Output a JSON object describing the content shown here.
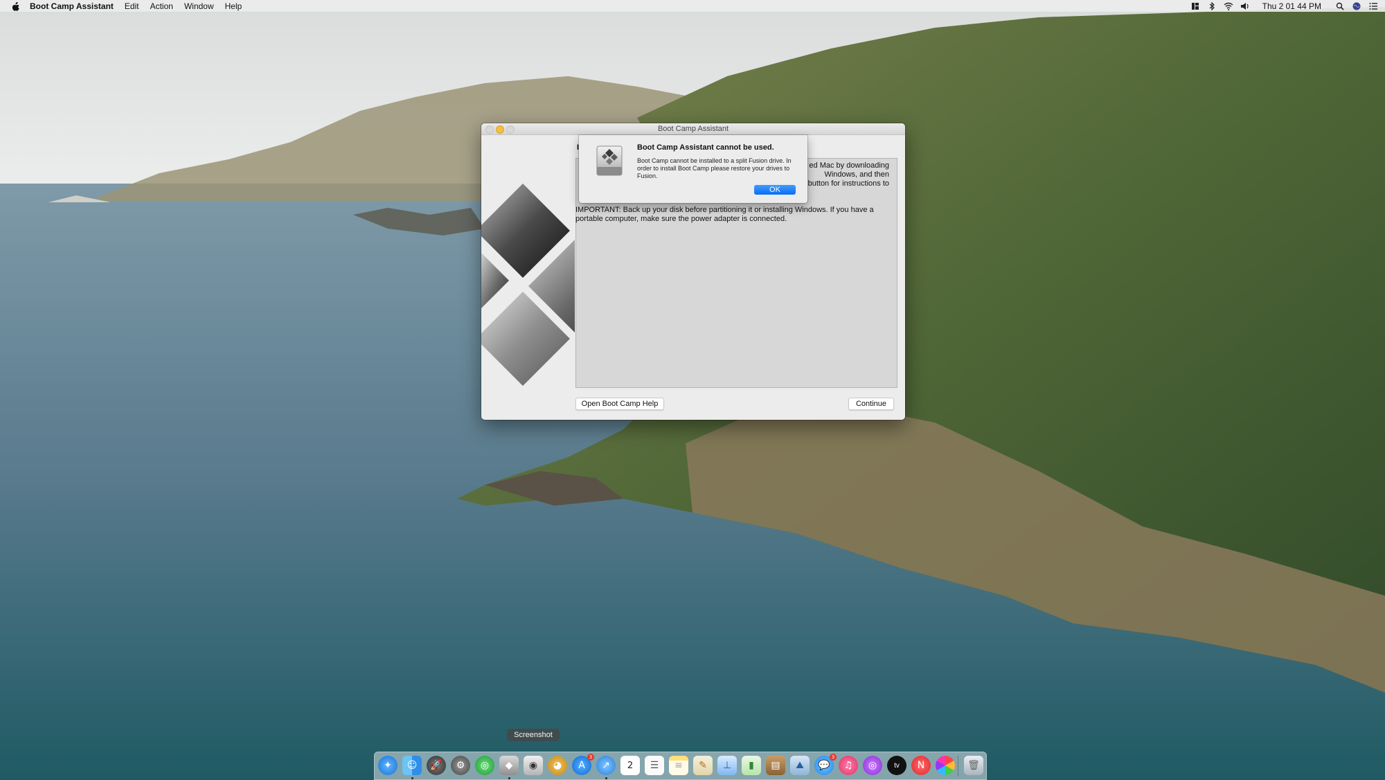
{
  "menubar": {
    "app_name": "Boot Camp Assistant",
    "menus": [
      "Edit",
      "Action",
      "Window",
      "Help"
    ],
    "clock": "Thu 2 01 44 PM",
    "status_icons": [
      "control-strip-icon",
      "bluetooth-icon",
      "wifi-icon",
      "volume-icon",
      "spotlight-icon",
      "siri-icon",
      "notification-center-icon"
    ]
  },
  "window": {
    "title": "Boot Camp Assistant",
    "title_fragment": "I",
    "intro_lines": [
      "ed Mac by downloading",
      "Windows, and then",
      "button for instructions to"
    ],
    "important_text": "IMPORTANT:  Back up your disk before partitioning it or installing Windows. If you have a portable computer, make sure the power adapter is connected.",
    "help_button": "Open Boot Camp Help",
    "continue_button": "Continue"
  },
  "alert": {
    "title": "Boot Camp Assistant cannot be used.",
    "body": "Boot Camp cannot be installed to a split Fusion drive. In order to install Boot Camp please restore your drives to Fusion.",
    "ok_label": "OK"
  },
  "dock": {
    "tooltip": "Screenshot",
    "calendar_day": "2",
    "badges": {
      "app_store": "3",
      "messages": "3"
    },
    "tv_label": "tv"
  },
  "colors": {
    "accent": "#0a6ff0",
    "menubar": "#ececec",
    "window_bg": "#ececec"
  }
}
